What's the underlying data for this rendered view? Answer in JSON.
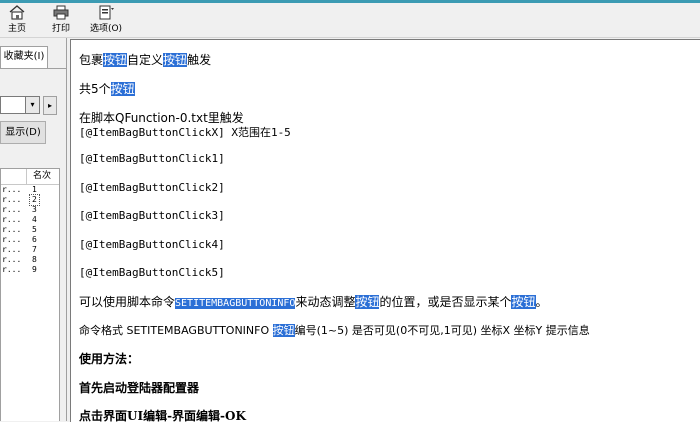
{
  "toolbar": {
    "home": "主页",
    "print": "打印",
    "options": "选项(O)"
  },
  "left": {
    "tab_label": "收藏夹(I)",
    "nav_arrow": "▸",
    "combo_arrow": "▾",
    "show_button": "显示(D)",
    "list_header": "名次",
    "rows": [
      {
        "col1": "r...",
        "col2": "1"
      },
      {
        "col1": "r...",
        "col2": "2"
      },
      {
        "col1": "r...",
        "col2": "3"
      },
      {
        "col1": "r...",
        "col2": "4"
      },
      {
        "col1": "r...",
        "col2": "5"
      },
      {
        "col1": "r...",
        "col2": "6"
      },
      {
        "col1": "r...",
        "col2": "7"
      },
      {
        "col1": "r...",
        "col2": "8"
      },
      {
        "col1": "r...",
        "col2": "9"
      }
    ]
  },
  "content": {
    "l1": [
      "包裹",
      "按钮",
      "自定义",
      "按钮",
      "触发"
    ],
    "l2": [
      "共5个",
      "按钮"
    ],
    "l3": "在脚本QFunction-0.txt里触发",
    "l4": "[@ItemBagButtonClickX] X范围在1-5",
    "l5": "[@ItemBagButtonClick1]",
    "l6": "[@ItemBagButtonClick2]",
    "l7": "[@ItemBagButtonClick3]",
    "l8": "[@ItemBagButtonClick4]",
    "l9": "[@ItemBagButtonClick5]",
    "l10": [
      "可以使用脚本命令",
      "SETITEMBAGBUTTONINFO",
      "来动态调整",
      "按钮",
      "的位置，或是否显示某个",
      "按钮",
      "。"
    ],
    "l11": [
      "命令格式 SETITEMBAGBUTTONINFO ",
      "按钮",
      "编号(1~5) 是否可见(0不可见,1可见) 坐标X 坐标Y 提示信息"
    ],
    "l12": "使用方法：",
    "l13": "首先启动登陆器配置器",
    "l14": "点击界面UI编辑-界面编辑-OK"
  }
}
